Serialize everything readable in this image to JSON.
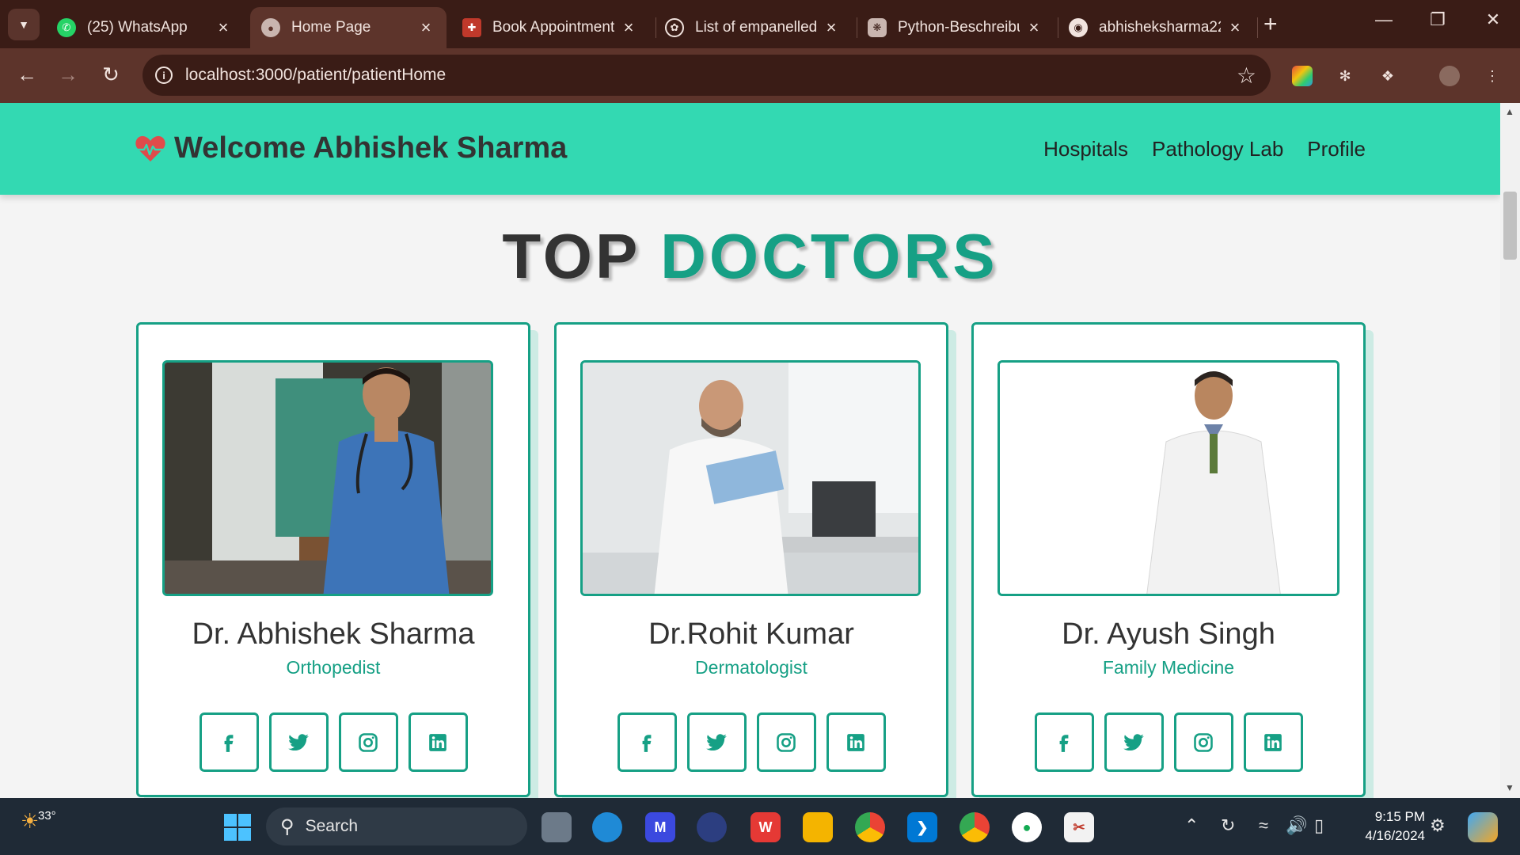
{
  "browser": {
    "tabs": [
      {
        "title": "(25) WhatsApp",
        "icon": "whatsapp-icon",
        "active": false
      },
      {
        "title": "Home Page",
        "icon": "globe-icon",
        "active": true
      },
      {
        "title": "Book Appointment",
        "icon": "appointment-icon",
        "active": false
      },
      {
        "title": "List of empanelled",
        "icon": "emblem-icon",
        "active": false
      },
      {
        "title": "Python-Beschreibu",
        "icon": "chatgpt-icon",
        "active": false
      },
      {
        "title": "abhisheksharma22",
        "icon": "github-icon",
        "active": false
      }
    ],
    "url": "localhost:3000/patient/patientHome"
  },
  "navbar": {
    "brand": "Welcome Abhishek Sharma",
    "links": [
      "Hospitals",
      "Pathology Lab",
      "Profile"
    ],
    "accent": "#33d9b2"
  },
  "heading": {
    "part1": "TOP",
    "part2": "DOCTORS"
  },
  "doctors": [
    {
      "name": "Dr. Abhishek Sharma",
      "specialty": "Orthopedist"
    },
    {
      "name": "Dr.Rohit Kumar",
      "specialty": "Dermatologist"
    },
    {
      "name": "Dr. Ayush Singh",
      "specialty": "Family Medicine"
    }
  ],
  "social_icons": [
    "facebook-icon",
    "twitter-icon",
    "instagram-icon",
    "linkedin-icon"
  ],
  "colors": {
    "primary": "#16a085",
    "navbar": "#33d9b2",
    "heart": "#e04b4b"
  },
  "taskbar": {
    "weather": "33°",
    "search_label": "Search",
    "time": "9:15 PM",
    "date": "4/16/2024"
  }
}
